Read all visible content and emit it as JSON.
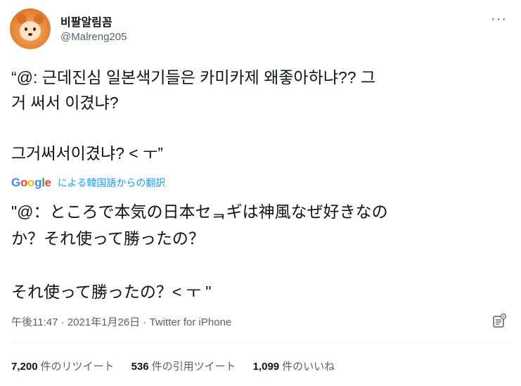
{
  "user": {
    "display_name": "비팔알림꼼",
    "handle": "@Malreng205"
  },
  "tweet": {
    "text": "“@: 근데진심 일본색기들은 카미카제 왜좋아하냐?? 그\n거 써서 이겼냐?\n\n그거써서이겼냐? < ㅜ”",
    "translation_label": "による韓国語からの翻訳",
    "translated_text": "\"@：ところで本気の日本セᆿギは神風なぜ好きなの\nか？それ使って勝ったの？\n\nそれ使って勝ったの？< ㅜ \"",
    "time": "午後11:47",
    "date": "2021年1月26日",
    "source": "Twitter for iPhone",
    "separator": " · "
  },
  "google_logo": {
    "letters": [
      "G",
      "o",
      "o",
      "g",
      "l",
      "e"
    ],
    "colors": [
      "#4285F4",
      "#EA4335",
      "#FBBC05",
      "#4285F4",
      "#34A853",
      "#EA4335"
    ]
  },
  "stats": {
    "retweets": {
      "count": "7,200",
      "label": "件のリツイート"
    },
    "quotes": {
      "count": "536",
      "label": "件の引用ツイート"
    },
    "likes": {
      "count": "1,099",
      "label": "件のいいね"
    }
  },
  "icons": {
    "more": "more-icon",
    "analytics": "analytics-icon"
  },
  "colors": {
    "primary_text": "#0f1419",
    "secondary_text": "#536471",
    "link": "#1d9bf0",
    "divider": "#eff3f4"
  }
}
